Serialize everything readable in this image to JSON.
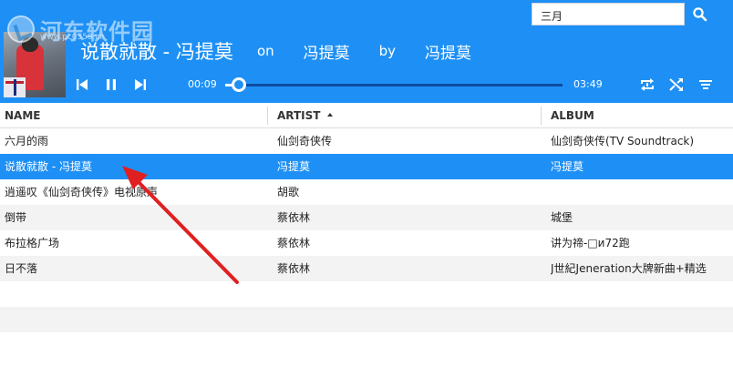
{
  "player": {
    "song_title": "说散就散 - 冯提莫",
    "on_label": "on",
    "album": "冯提莫",
    "by_label": "by",
    "artist": "冯提莫",
    "elapsed": "00:09",
    "total": "03:49",
    "progress": 0.04
  },
  "search": {
    "value": "三月"
  },
  "watermark": {
    "text": "河东软件园",
    "url": "www.pc0359.cn"
  },
  "table": {
    "columns": [
      {
        "label": "NAME"
      },
      {
        "label": "ARTIST",
        "sorted": "ascending"
      },
      {
        "label": "ALBUM"
      }
    ],
    "rows": [
      {
        "name": "六月的雨",
        "artist": "仙剑奇侠传",
        "album": "仙剑奇侠传(TV Soundtrack)"
      },
      {
        "name": "说散就散 - 冯提莫",
        "artist": "冯提莫",
        "album": "冯提莫",
        "selected": true
      },
      {
        "name": "逍遥叹《仙剑奇侠传》电视原声",
        "artist": "胡歌",
        "album": ""
      },
      {
        "name": "倒带",
        "artist": "蔡依林",
        "album": "城堡"
      },
      {
        "name": "布拉格广场",
        "artist": "蔡依林",
        "album": "讲为禘-□и72跑"
      },
      {
        "name": "日不落",
        "artist": "蔡依林",
        "album": "J世紀Jeneration大牌新曲+精选"
      }
    ]
  },
  "colors": {
    "accent": "#1e90f5",
    "annotation_arrow": "#e02020"
  }
}
